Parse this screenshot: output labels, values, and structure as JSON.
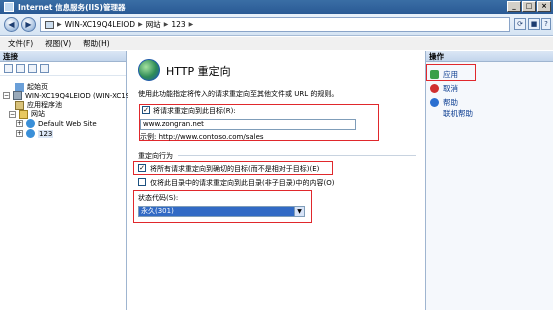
{
  "window": {
    "title": "Internet 信息服务(IIS)管理器"
  },
  "address": {
    "crumbs": [
      "WIN-XC19Q4LEIOD",
      "网站",
      "123"
    ]
  },
  "menu": {
    "items": [
      "文件(F)",
      "视图(V)",
      "帮助(H)"
    ]
  },
  "left_pane": {
    "header": "连接",
    "tree": [
      {
        "label": "起始页"
      },
      {
        "label": "WIN-XC19Q4LEIOD (WIN-XC19Q"
      },
      {
        "label": "应用程序池"
      },
      {
        "label": "网站"
      },
      {
        "label": "Default Web Site"
      },
      {
        "label": "123"
      }
    ]
  },
  "main": {
    "title": "HTTP 重定向",
    "description": "使用此功能指定将传入的请求重定向至其他文件或 URL 的规则。",
    "redirect_checkbox_label": "将请求重定向到此目标(R):",
    "url_value": "www.zongran.net",
    "example": "示例:  http://www.contoso.com/sales",
    "behavior_header": "重定向行为",
    "option1": "将所有请求重定向到确切的目标(而不是相对于目标)(E)",
    "option1_checked": true,
    "option2": "仅将此目录中的请求重定向到此目录(非子目录)中的内容(O)",
    "option2_checked": false,
    "status_label": "状态代码(S):",
    "status_value": "永久(301)"
  },
  "right_pane": {
    "header": "操作",
    "actions": [
      {
        "label": "应用",
        "icon": "apply-icon"
      },
      {
        "label": "取消",
        "icon": "cancel-icon"
      },
      {
        "label": "帮助",
        "icon": "help-icon"
      },
      {
        "label": "联机帮助",
        "icon": ""
      }
    ]
  },
  "colors": {
    "highlight_box": "#e0282c",
    "selection": "#316ac5"
  }
}
